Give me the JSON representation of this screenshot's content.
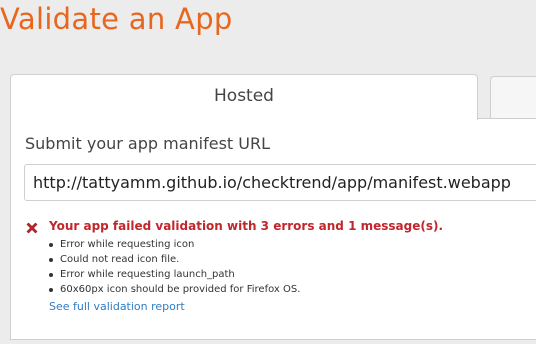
{
  "page": {
    "title": "Validate an App"
  },
  "tabs": [
    {
      "label": "Hosted",
      "active": true
    },
    {
      "label": "",
      "active": false
    }
  ],
  "form": {
    "manifest_label": "Submit your app manifest URL",
    "manifest_url": "http://tattyamm.github.io/checktrend/app/manifest.webapp"
  },
  "validation": {
    "icon": "error-x-icon",
    "headline": "Your app failed validation with 3 errors and 1 message(s).",
    "messages": [
      "Error while requesting icon",
      "Could not read icon file.",
      "Error while requesting launch_path",
      "60x60px icon should be provided for Firefox OS."
    ],
    "report_link": "See full validation report"
  },
  "colors": {
    "title": "#e7671f",
    "error": "#c0272d",
    "link": "#2f7dc3"
  }
}
